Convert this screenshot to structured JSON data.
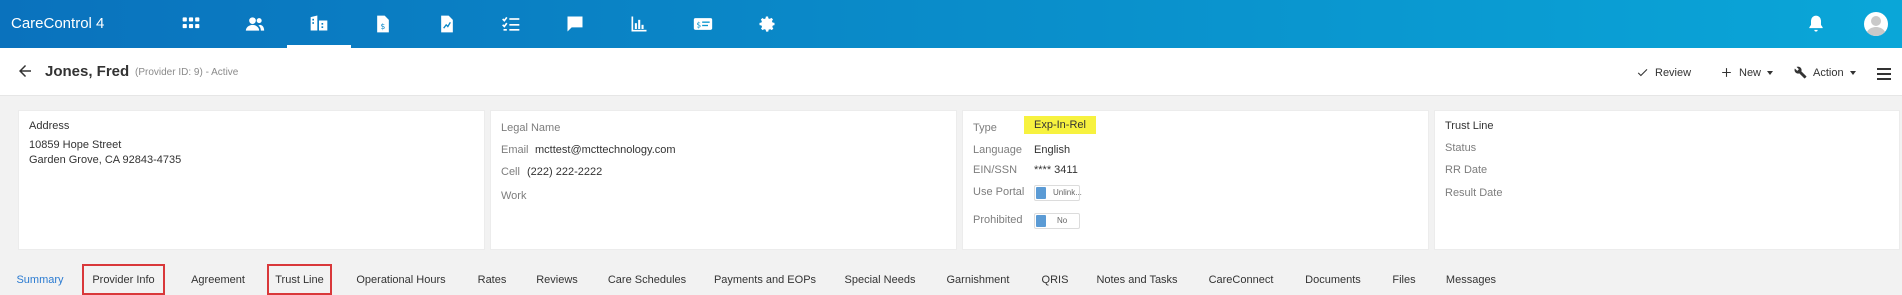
{
  "app": {
    "title": "CareControl 4"
  },
  "nav": [
    {
      "name": "apps-grid-icon"
    },
    {
      "name": "people-icon"
    },
    {
      "name": "building-icon"
    },
    {
      "name": "billing-document-icon"
    },
    {
      "name": "chart-document-icon"
    },
    {
      "name": "checklist-icon"
    },
    {
      "name": "chat-icon"
    },
    {
      "name": "bar-chart-icon"
    },
    {
      "name": "payment-card-icon"
    },
    {
      "name": "settings-gear-icon"
    }
  ],
  "header": {
    "name": "Jones, Fred",
    "subinfo": "(Provider ID: 9) - Active",
    "review_label": "Review",
    "new_label": "New",
    "action_label": "Action"
  },
  "address_card": {
    "label": "Address",
    "line1": "10859 Hope Street",
    "line2": "Garden Grove, CA 92843-4735"
  },
  "contact_card": {
    "legal_name_label": "Legal Name",
    "email_label": "Email",
    "email": "mcttest@mcttechnology.com",
    "cell_label": "Cell",
    "cell": "(222) 222-2222",
    "work_label": "Work"
  },
  "type_card": {
    "type_label": "Type",
    "type_value": "Exp-In-Rel",
    "language_label": "Language",
    "language_value": "English",
    "ein_label": "EIN/SSN",
    "ein_value": "**** 3411",
    "portal_label": "Use Portal",
    "portal_value": "Unlink...",
    "prohibited_label": "Prohibited",
    "prohibited_value": "No",
    "highlight_color": "#f7f23f"
  },
  "trust_card": {
    "title": "Trust Line",
    "status_label": "Status",
    "rr_label": "RR Date",
    "result_label": "Result Date"
  },
  "tabs": [
    {
      "label": "Summary"
    },
    {
      "label": "Provider Info"
    },
    {
      "label": "Agreement"
    },
    {
      "label": "Trust Line"
    },
    {
      "label": "Operational Hours"
    },
    {
      "label": "Rates"
    },
    {
      "label": "Reviews"
    },
    {
      "label": "Care Schedules"
    },
    {
      "label": "Payments and EOPs"
    },
    {
      "label": "Special Needs"
    },
    {
      "label": "Garnishment"
    },
    {
      "label": "QRIS"
    },
    {
      "label": "Notes and Tasks"
    },
    {
      "label": "CareConnect"
    },
    {
      "label": "Documents"
    },
    {
      "label": "Files"
    },
    {
      "label": "Messages"
    }
  ],
  "colors": {
    "accent": "#2b7bd1",
    "topbar": "#0a8fcb",
    "tab_outline": "#d9383a"
  }
}
